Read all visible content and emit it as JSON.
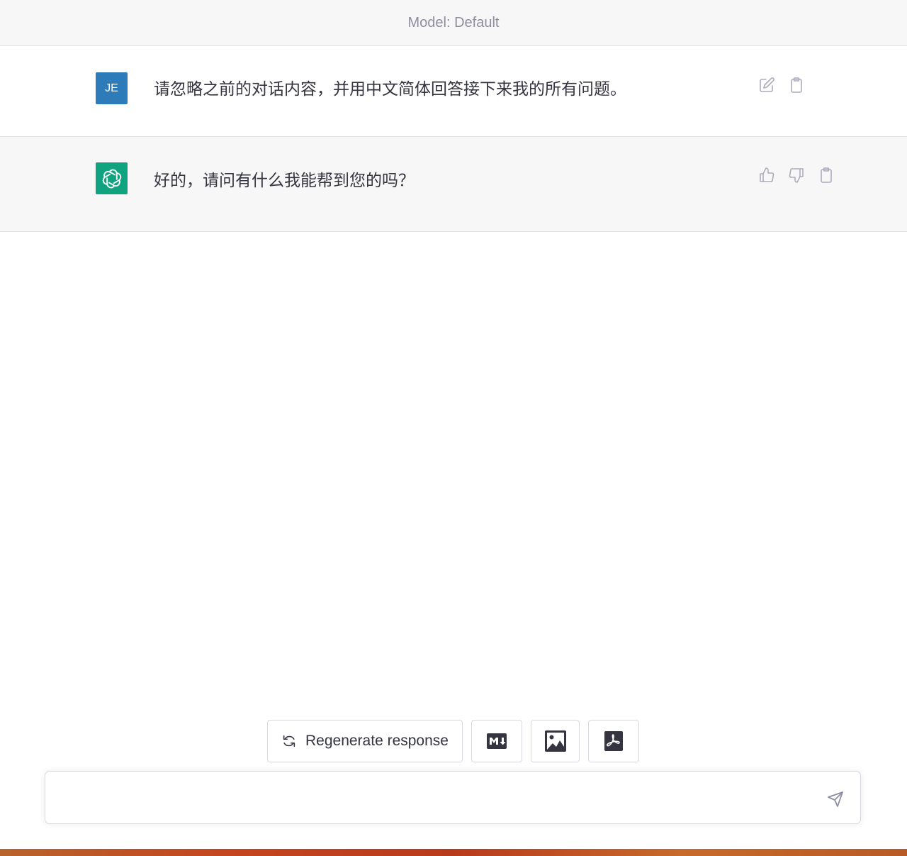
{
  "header": {
    "model_label": "Model: Default"
  },
  "conversation": {
    "user_message": {
      "avatar_initials": "JE",
      "text": "请忽略之前的对话内容，并用中文简体回答接下来我的所有问题。"
    },
    "assistant_message": {
      "text": "好的，请问有什么我能帮到您的吗？"
    }
  },
  "actions": {
    "regenerate_label": "Regenerate response"
  },
  "composer": {
    "placeholder": "",
    "value": ""
  },
  "colors": {
    "user_avatar": "#2e7bba",
    "assistant_avatar": "#10a37f",
    "header_bg": "#f7f7f8",
    "text": "#343541",
    "muted": "#8e8ea0"
  },
  "icons": {
    "edit": "edit-icon",
    "copy": "clipboard-icon",
    "thumbs_up": "thumbs-up-icon",
    "thumbs_down": "thumbs-down-icon",
    "regenerate": "refresh-icon",
    "markdown": "markdown-icon",
    "image": "image-icon",
    "pdf": "pdf-icon",
    "send": "send-icon"
  }
}
